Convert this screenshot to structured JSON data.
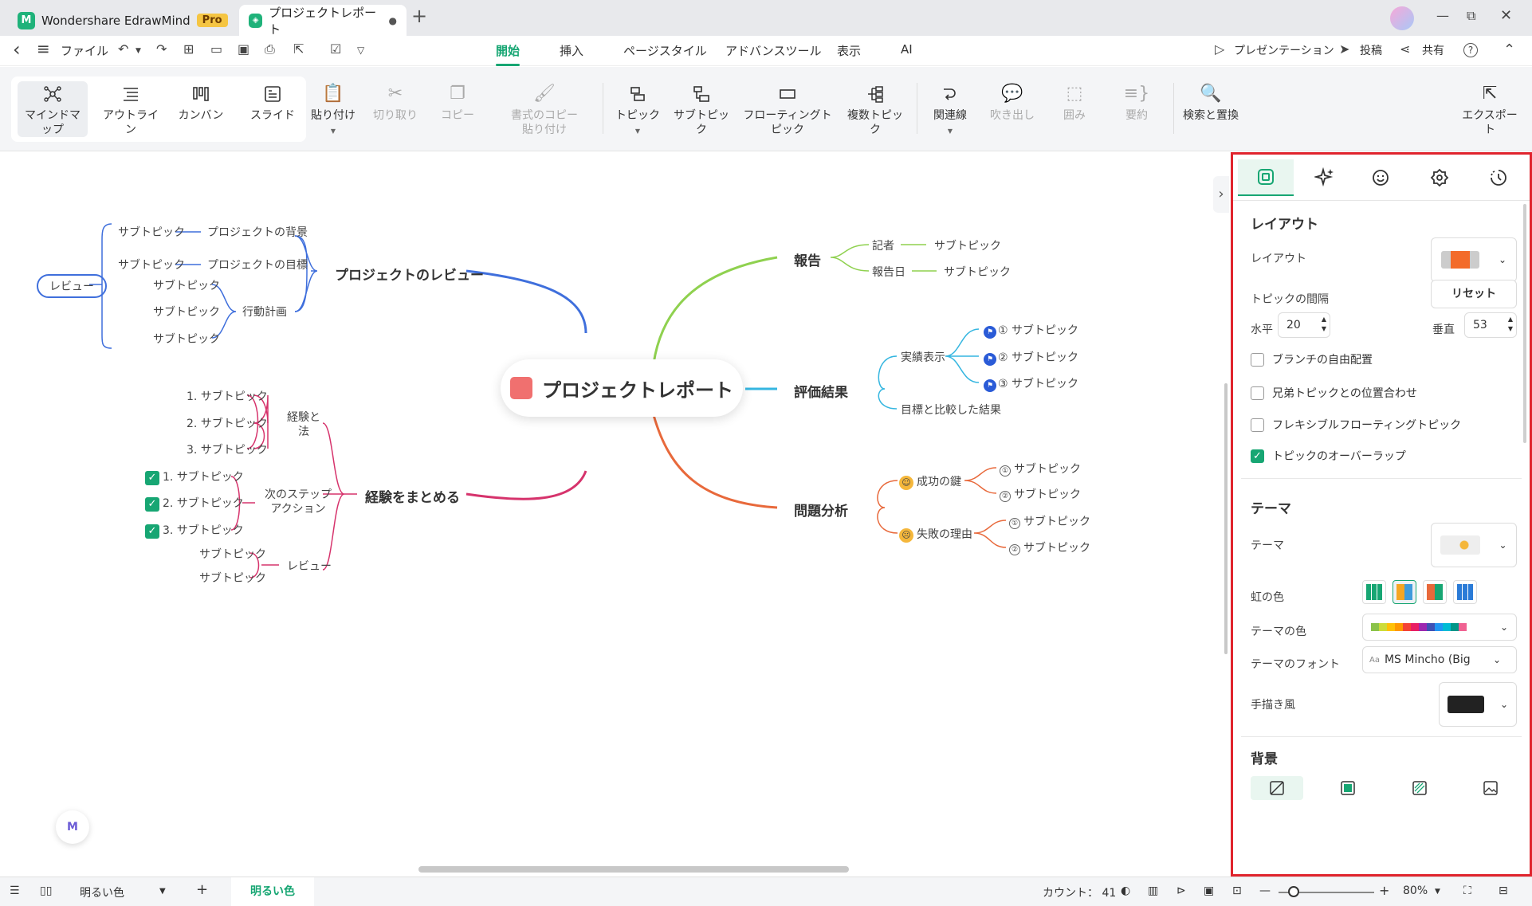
{
  "app": {
    "name": "Wondershare EdrawMind",
    "badge": "Pro",
    "doc_tab": "プロジェクトレポート",
    "add_tab": "+"
  },
  "window": {
    "minimize": "—",
    "restore": "⧉",
    "close": "✕"
  },
  "menu": {
    "back": "‹",
    "hamburger": "≡",
    "file": "ファイル",
    "tabs": [
      "開始",
      "挿入",
      "ページスタイル",
      "アドバンスツール",
      "表示",
      "AI"
    ],
    "present": "プレゼンテーション",
    "post": "投稿",
    "share": "共有",
    "help": "?"
  },
  "ribbon": {
    "views": [
      "マインドマップ",
      "アウトライン",
      "カンバン",
      "スライド"
    ],
    "paste": "貼り付け",
    "cut": "切り取り",
    "copy": "コピー",
    "format_copy": "書式のコピー",
    "format_paste": "貼り付け",
    "topic": "トピック",
    "subtopic": "サブトピック",
    "floating": "フローティングトピック",
    "multi": "複数トピック",
    "relation": "関連線",
    "callout": "吹き出し",
    "boundary": "囲み",
    "summary": "要約",
    "find": "検索と置換",
    "export": "エクスポート"
  },
  "mindmap": {
    "central": "プロジェクトレポート",
    "left": {
      "review": {
        "title": "プロジェクトのレビュー",
        "label": "レビュー",
        "items": [
          "サブトピック",
          "プロジェクトの背景",
          "サブトピック",
          "プロジェクトの目標",
          "サブトピック",
          "サブトピック",
          "サブトピック",
          "行動計画"
        ]
      },
      "summary": {
        "title": "経験をまとめる",
        "g1": [
          "1. サブトピック",
          "2. サブトピック",
          "3. サブトピック"
        ],
        "g1_label": [
          "経験と",
          "法"
        ],
        "g2": [
          "1. サブトピック",
          "2. サブトピック",
          "3. サブトピック"
        ],
        "g2_label": [
          "次のステップ",
          "アクション"
        ],
        "g3": [
          "サブトピック",
          "サブトピック"
        ],
        "g3_label": "レビュー",
        "check": "✓"
      }
    },
    "right": {
      "report": {
        "title": "報告",
        "a": "記者",
        "b": "報告日",
        "sub": "サブトピック"
      },
      "eval": {
        "title": "評価結果",
        "a": "実績表示",
        "b": "目標と比較した結果",
        "subs": [
          "① サブトピック",
          "② サブトピック",
          "③ サブトピック"
        ]
      },
      "analysis": {
        "title": "問題分析",
        "a": "成功の鍵",
        "b": "失敗の理由",
        "subs": [
          "サブトピック",
          "サブトピック",
          "サブトピック",
          "サブトピック"
        ],
        "nums": [
          "①",
          "②",
          "①",
          "②"
        ]
      }
    }
  },
  "panel": {
    "layout_section": "レイアウト",
    "layout_label": "レイアウト",
    "spacing_label": "トピックの間隔",
    "reset": "リセット",
    "horizontal": "水平",
    "horizontal_value": "20",
    "vertical": "垂直",
    "vertical_value": "53",
    "options": [
      {
        "label": "ブランチの自由配置",
        "checked": false
      },
      {
        "label": "兄弟トピックとの位置合わせ",
        "checked": false
      },
      {
        "label": "フレキシブルフローティングトピック",
        "checked": false
      },
      {
        "label": "トピックのオーバーラップ",
        "checked": true
      }
    ],
    "theme_section": "テーマ",
    "theme_label": "テーマ",
    "rainbow_label": "虹の色",
    "theme_color_label": "テーマの色",
    "theme_font_label": "テーマのフォント",
    "theme_font_value": "MS Mincho (Big",
    "font_prefix": "Aa",
    "handdrawn_label": "手描き風",
    "background_section": "背景",
    "swatch_colors": [
      "#8bc34a",
      "#cddc39",
      "#ffc107",
      "#ff9800",
      "#f44336",
      "#e91e63",
      "#9c27b0",
      "#3f51b5",
      "#2196f3",
      "#00bcd4",
      "#009688",
      "#f06292"
    ]
  },
  "status": {
    "theme_select": "明るい色",
    "page_tab": "明るい色",
    "add": "+",
    "count": "カウント： 41",
    "zoom": "80%",
    "minus": "—",
    "plus": "+"
  },
  "colors": {
    "accent": "#17a673",
    "blue": "#3f6fdc",
    "pink": "#d6336c",
    "green": "#8fd14f",
    "cyan": "#35b6e0",
    "orange": "#e8693b",
    "highlight": "#e0242d"
  }
}
